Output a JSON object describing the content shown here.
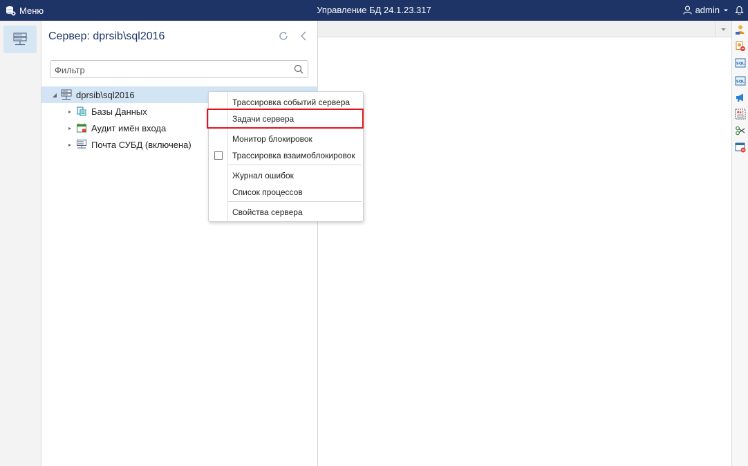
{
  "titlebar": {
    "menu_label": "Меню",
    "app_title": "Управление БД 24.1.23.317",
    "user": "admin"
  },
  "panel": {
    "title": "Сервер: dprsib\\sql2016",
    "filter_placeholder": "Фильтр"
  },
  "tree": {
    "root": "dprsib\\sql2016",
    "children": [
      "Базы Данных",
      "Аудит имён входа",
      "Почта СУБД (включена)"
    ]
  },
  "context_menu": {
    "items": [
      "Трассировка событий сервера",
      "Задачи сервера",
      "Монитор блокировок",
      "Трассировка взаимоблокировок",
      "Журнал ошибок",
      "Список процессов",
      "Свойства сервера"
    ],
    "highlighted": "Задачи сервера"
  },
  "icons": {
    "menu": "database-stack-icon",
    "user": "user-icon",
    "bell": "bell-icon",
    "refresh": "refresh-icon",
    "collapse": "chevron-left-icon",
    "search": "search-icon"
  },
  "colors": {
    "titlebar": "#1e3466",
    "selection": "#d3e5f5",
    "highlight_border": "#e0141e"
  }
}
